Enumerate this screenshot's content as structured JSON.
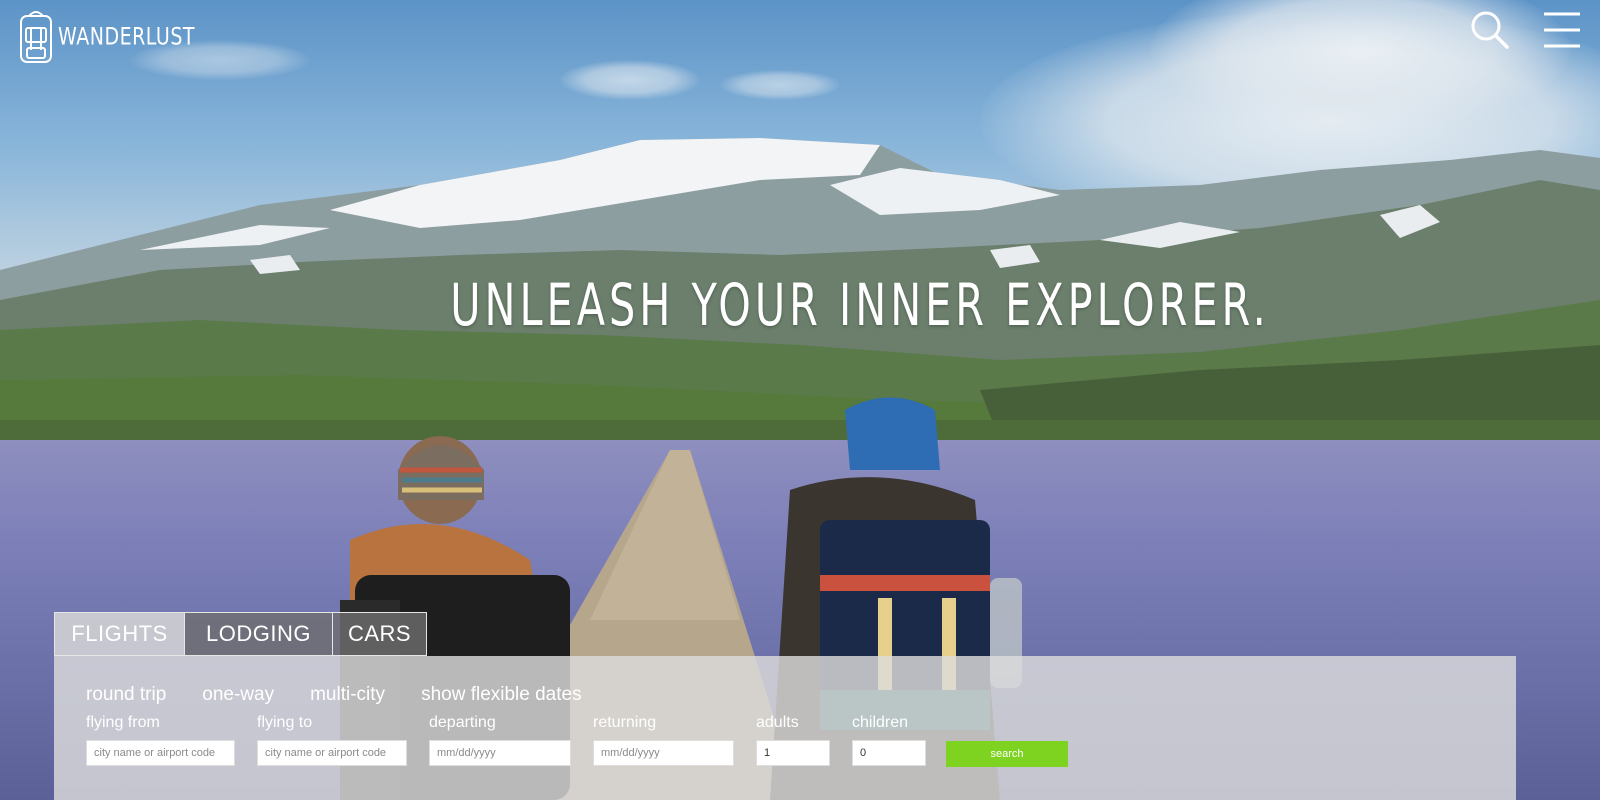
{
  "brand": {
    "name": "WANDERLUST"
  },
  "header": {
    "search_icon": "search-icon",
    "menu_icon": "hamburger-menu-icon"
  },
  "hero": {
    "headline": "UNLEASH YOUR INNER EXPLORER."
  },
  "search_widget": {
    "tabs": [
      {
        "label": "FLIGHTS",
        "active": true
      },
      {
        "label": "LODGING",
        "active": false
      },
      {
        "label": "CARS",
        "active": false
      }
    ],
    "trip_types": [
      "round trip",
      "one-way",
      "multi-city",
      "show flexible dates"
    ],
    "fields": {
      "flying_from": {
        "label": "flying from",
        "placeholder": "city name or airport code",
        "value": ""
      },
      "flying_to": {
        "label": "flying to",
        "placeholder": "city name or airport code",
        "value": ""
      },
      "departing": {
        "label": "departing",
        "placeholder": "mm/dd/yyyy",
        "value": ""
      },
      "returning": {
        "label": "returning",
        "placeholder": "mm/dd/yyyy",
        "value": ""
      },
      "adults": {
        "label": "adults",
        "value": "1"
      },
      "children": {
        "label": "children",
        "value": "0"
      }
    },
    "search_button": "search"
  },
  "colors": {
    "accent_green": "#7ed321",
    "panel": "#dcdcdc",
    "tab_inactive": "#6e6e6e"
  }
}
